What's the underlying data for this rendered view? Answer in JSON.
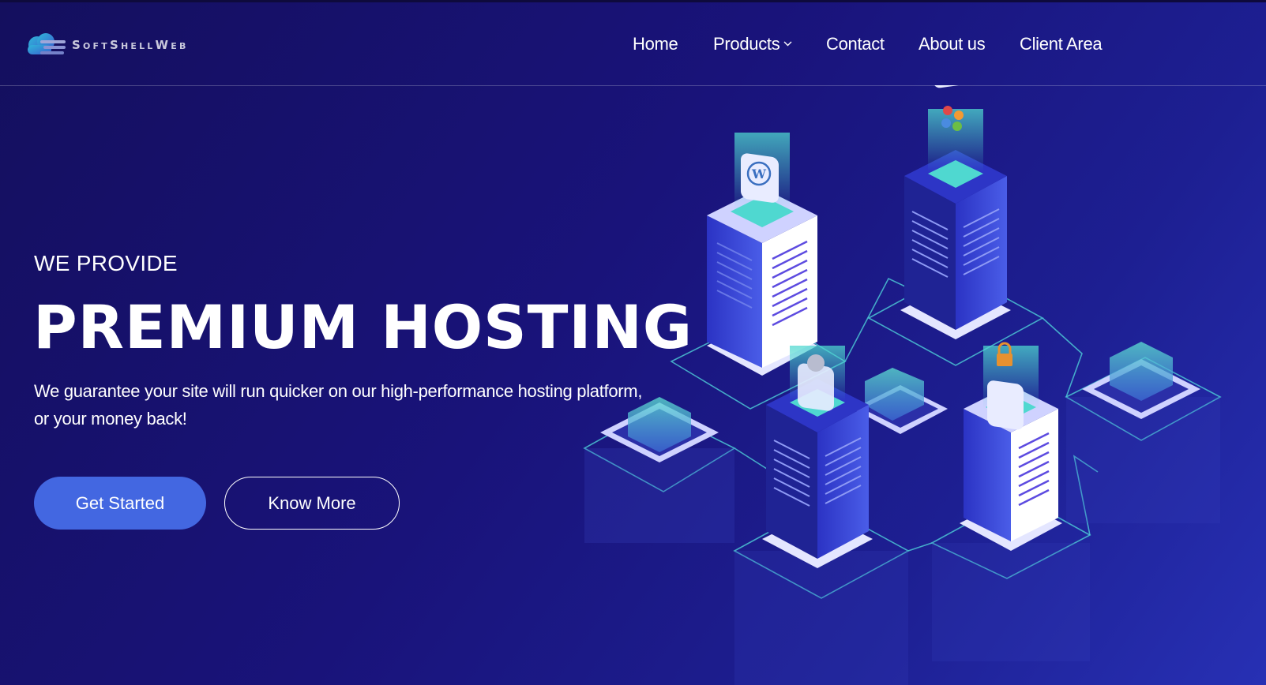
{
  "brand": {
    "name": "SoftShellWeb",
    "accent": "#4367e1"
  },
  "nav": {
    "items": [
      {
        "label": "Home"
      },
      {
        "label": "Products",
        "has_dropdown": true
      },
      {
        "label": "Contact"
      },
      {
        "label": "About us"
      },
      {
        "label": "Client Area"
      }
    ]
  },
  "hero": {
    "eyebrow": "WE PROVIDE",
    "headline": "PREMIUM HOSTING",
    "lead": "We guarantee your site will run quicker on our high-performance hosting platform, or your money back!",
    "primary_button": "Get Started",
    "secondary_button": "Know More"
  },
  "illustration": {
    "icons": [
      "wordpress-icon",
      "joomla-icon",
      "cloud-icon",
      "lock-icon"
    ]
  }
}
